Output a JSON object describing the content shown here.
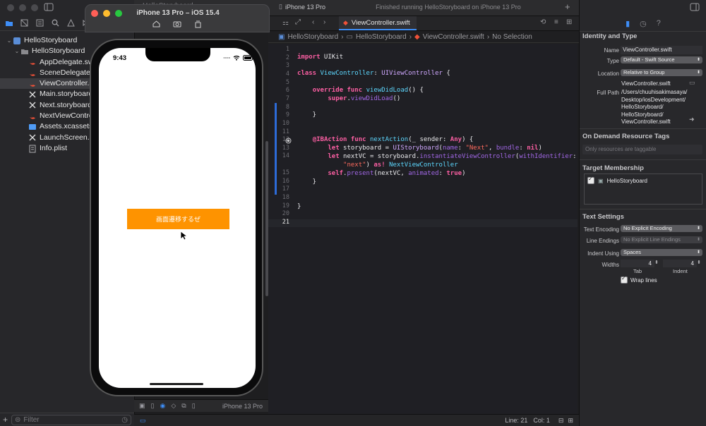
{
  "navigator": {
    "filter_placeholder": "Filter",
    "tree": [
      {
        "label": "HelloStoryboard",
        "kind": "project",
        "indent": 0
      },
      {
        "label": "HelloStoryboard",
        "kind": "folder",
        "indent": 1
      },
      {
        "label": "AppDelegate.swift",
        "kind": "swift",
        "indent": 2
      },
      {
        "label": "SceneDelegate.sw",
        "kind": "swift",
        "indent": 2
      },
      {
        "label": "ViewController.swi",
        "kind": "swift",
        "indent": 2,
        "selected": true
      },
      {
        "label": "Main.storyboard",
        "kind": "storyboard",
        "indent": 2
      },
      {
        "label": "Next.storyboard",
        "kind": "storyboard",
        "indent": 2
      },
      {
        "label": "NextViewControll",
        "kind": "swift",
        "indent": 2
      },
      {
        "label": "Assets.xcassets",
        "kind": "assets",
        "indent": 2
      },
      {
        "label": "LaunchScreen.st",
        "kind": "storyboard",
        "indent": 2
      },
      {
        "label": "Info.plist",
        "kind": "plist",
        "indent": 2
      }
    ]
  },
  "toolbar": {
    "scheme": "HelloStoryboard",
    "device": "iPhone 13 Pro",
    "status": "Finished running HelloStoryboard on iPhone 13 Pro",
    "active_tab": "ViewController.swift"
  },
  "jumpbar": {
    "items": [
      "HelloStoryboard",
      "HelloStoryboard",
      "ViewController.swift",
      "No Selection"
    ]
  },
  "editor": {
    "line_numbers": [
      "1",
      "2",
      "3",
      "4",
      "5",
      "6",
      "7",
      "8",
      "9",
      "10",
      "11",
      "12",
      "13",
      "14",
      "15",
      "16",
      "17",
      "18",
      "19",
      "20",
      "21"
    ]
  },
  "simulator": {
    "title": "iPhone 13 Pro – iOS 15.4",
    "status_time": "9:43",
    "button_label": "画面遷移するぜ",
    "bottom_device": "iPhone 13 Pro"
  },
  "statusbar": {
    "line": "Line: 21",
    "col": "Col: 1"
  },
  "inspector": {
    "identity_header": "Identity and Type",
    "name_label": "Name",
    "name_value": "ViewController.swift",
    "type_label": "Type",
    "type_value": "Default - Swift Source",
    "location_label": "Location",
    "location_value": "Relative to Group",
    "location_file": "ViewController.swift",
    "fullpath_label": "Full Path",
    "fullpath_lines": [
      "/Users/chuuhisakimasaya/",
      "Desktop/iosDevelopment/",
      "HelloStoryboard/",
      "HelloStoryboard/",
      "ViewController.swift"
    ],
    "odr_header": "On Demand Resource Tags",
    "odr_placeholder": "Only resources are taggable",
    "target_header": "Target Membership",
    "target_item": "HelloStoryboard",
    "text_header": "Text Settings",
    "encoding_label": "Text Encoding",
    "encoding_value": "No Explicit Encoding",
    "line_endings_label": "Line Endings",
    "line_endings_value": "No Explicit Line Endings",
    "indent_label": "Indent Using",
    "indent_value": "Spaces",
    "widths_label": "Widths",
    "tab_value": "4",
    "indent_width_value": "4",
    "tab_caption": "Tab",
    "indent_caption": "Indent",
    "wrap_label": "Wrap lines"
  },
  "colors": {
    "accent": "#3e8ef7",
    "button": "#fe9300",
    "keyword": "#fc5fa3",
    "string": "#fc6a5d"
  }
}
